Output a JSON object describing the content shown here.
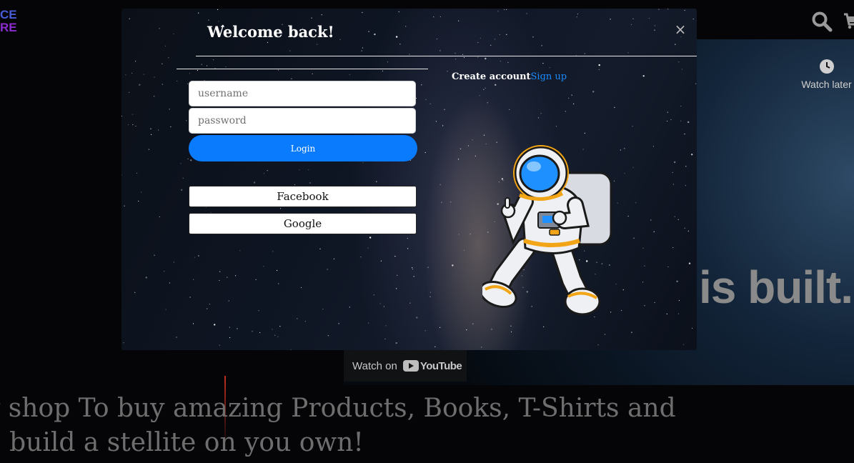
{
  "background": {
    "logo": {
      "line1": "CE",
      "line2": "RE"
    },
    "video": {
      "headline": "is built.",
      "watch_later_label": "Watch later",
      "watch_on_label": "Watch on",
      "youtube_label": "YouTube"
    },
    "tagline_lines": [
      "y shop To buy amazing Products, Books, T-Shirts and",
      "o build a stellite on you own!"
    ]
  },
  "modal": {
    "title": "Welcome back!",
    "close_label": "×",
    "username_placeholder": "username",
    "password_placeholder": "password",
    "login_label": "Login",
    "facebook_label": "Facebook",
    "google_label": "Google",
    "create_account_text": "Create account",
    "signup_label": "Sign up"
  },
  "colors": {
    "login_button": "#0a7bfc",
    "signup_link": "#1a8cff",
    "astronaut_visor": "#1e90ff",
    "astronaut_accent": "#f2a516"
  }
}
